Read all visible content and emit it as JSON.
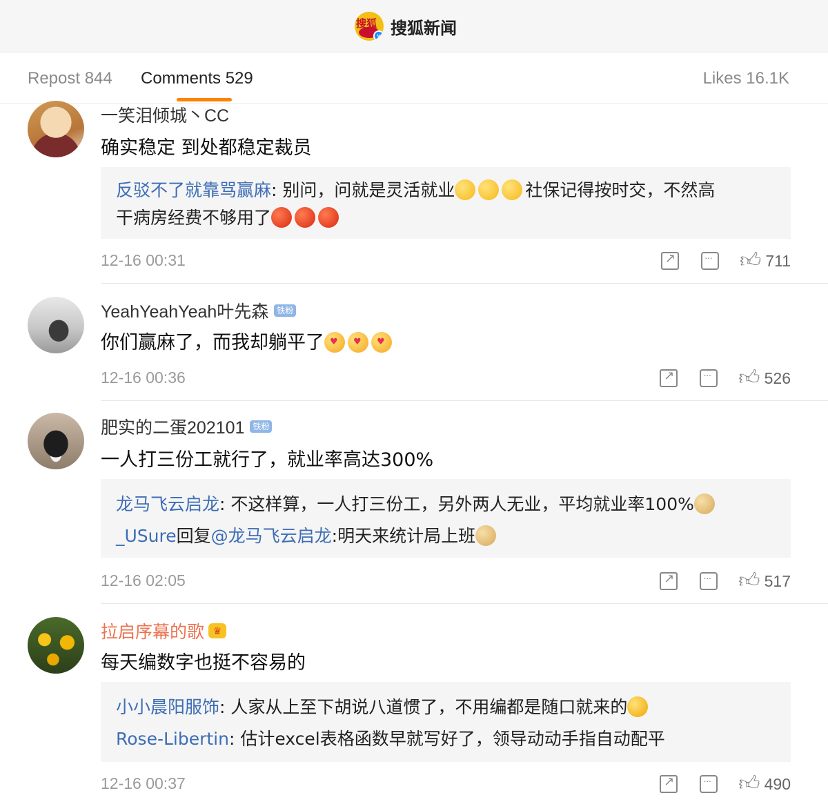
{
  "app": {
    "name": "搜狐新闻"
  },
  "tabs": {
    "repost": "Repost 844",
    "comments": "Comments 529",
    "likes": "Likes 16.1K"
  },
  "comments": [
    {
      "user": "一笑泪倾城丶CC",
      "text": "确实稳定 到处都稳定裁员",
      "replies": [
        {
          "name": "反驳不了就靠骂赢麻",
          "text_1": ": 别问，问就是灵活就业",
          "text_2": "社保记得按时交，不然高",
          "text_3": "干病房经费不够用了"
        }
      ],
      "time": "12-16 00:31",
      "likes": "711"
    },
    {
      "user": "YeahYeahYeah叶先森",
      "badge": "铁粉",
      "text": "你们赢麻了，而我却躺平了",
      "time": "12-16 00:36",
      "likes": "526"
    },
    {
      "user": "肥实的二蛋202101",
      "badge": "铁粉",
      "text": "一人打三份工就行了，就业率高达300%",
      "replies": [
        {
          "name": "龙马飞云启龙",
          "text": ": 不这样算，一人打三份工，另外两人无业，平均就业率100%"
        },
        {
          "name": "_USure",
          "mid": "回复",
          "mention": "@龙马飞云启龙",
          "text": ":明天来统计局上班"
        }
      ],
      "time": "12-16 02:05",
      "likes": "517"
    },
    {
      "user": "拉启序幕的歌",
      "text": "每天编数字也挺不容易的",
      "replies": [
        {
          "name": "小小晨阳服饰",
          "text": ": 人家从上至下胡说八道惯了，不用编都是随口就来的"
        },
        {
          "name": "Rose-Libertin",
          "text": ": 估计excel表格函数早就写好了，领导动动手指自动配平"
        }
      ],
      "time": "12-16 00:37",
      "likes": "490"
    }
  ],
  "icons": {
    "share": "share-icon",
    "comment": "comment-icon",
    "like": "thumbs-up-icon"
  },
  "colors": {
    "accent": "#ff8200",
    "link": "#3d6db5",
    "vip_name": "#eb7350"
  }
}
